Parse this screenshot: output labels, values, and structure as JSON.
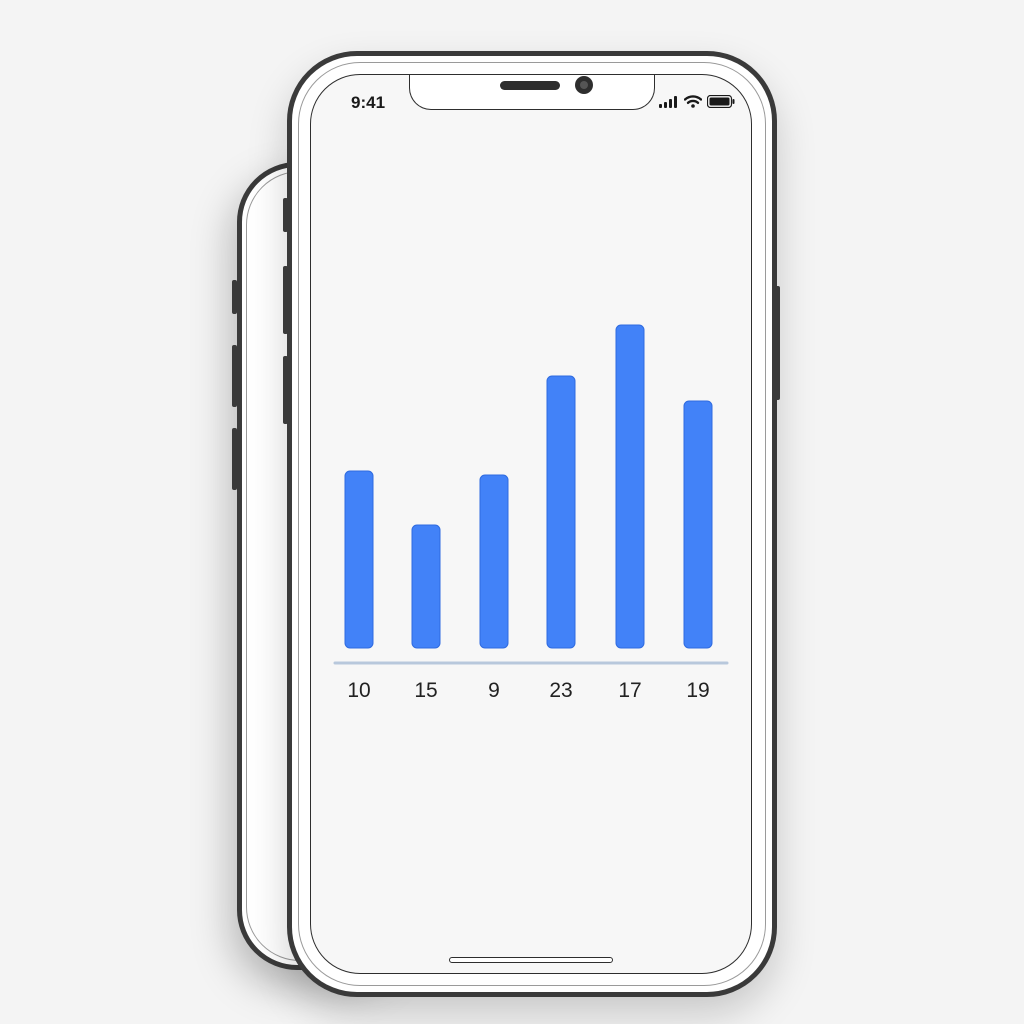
{
  "status_bar": {
    "time": "9:41",
    "icons": [
      "signal-icon",
      "wifi-icon",
      "battery-icon"
    ]
  },
  "colors": {
    "bar": "#4282f8",
    "bar_stroke": "#2f6be0",
    "baseline": "#b8c8dc"
  },
  "chart_data": {
    "type": "bar",
    "categories": [
      "10",
      "15",
      "9",
      "23",
      "17",
      "19"
    ],
    "values": [
      177,
      123,
      173,
      272,
      323,
      247
    ],
    "title": "",
    "xlabel": "",
    "ylabel": "",
    "ylim": [
      0,
      340
    ],
    "grid": false,
    "legend": "none"
  }
}
